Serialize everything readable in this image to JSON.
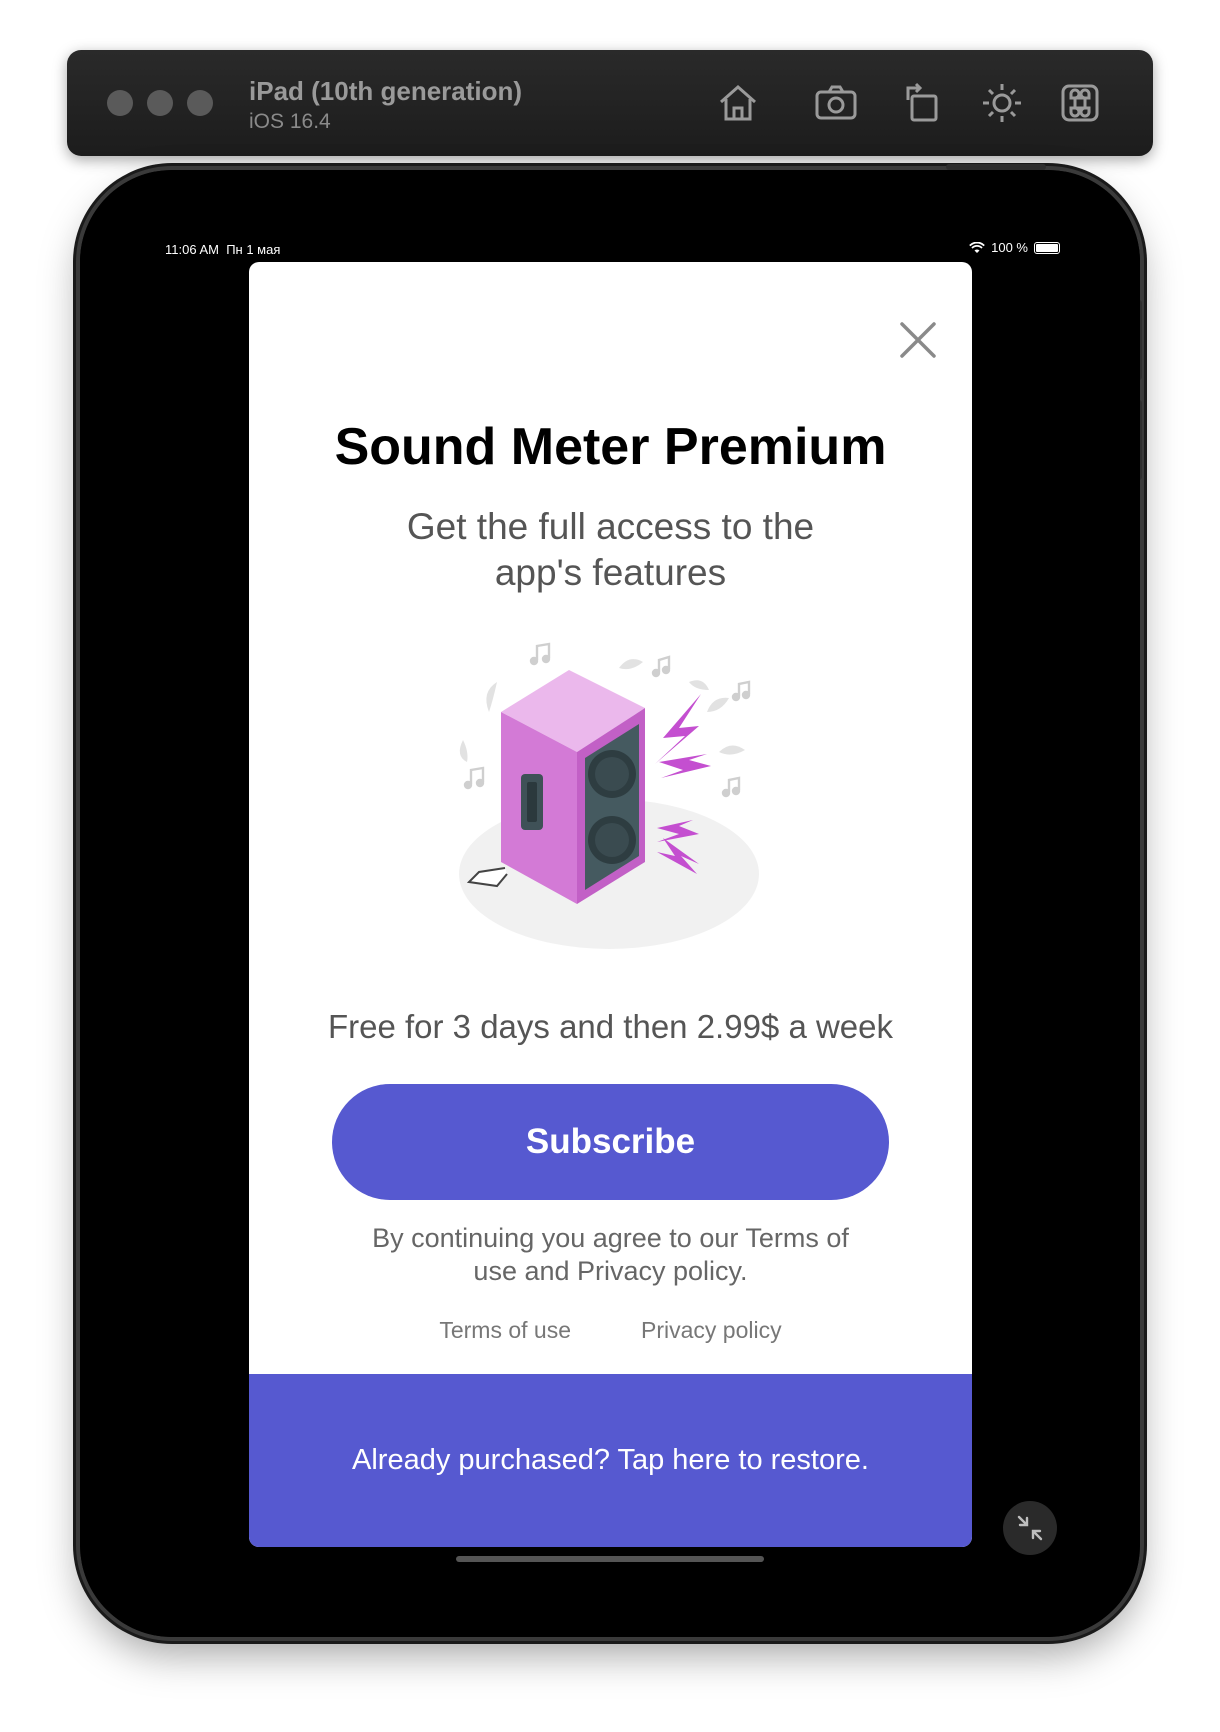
{
  "simulator": {
    "device_name": "iPad (10th generation)",
    "os_version": "iOS 16.4",
    "toolbar_icons": [
      "home-icon",
      "screenshot-icon",
      "rotate-icon",
      "appearance-icon",
      "command-icon"
    ]
  },
  "status_bar": {
    "time": "11:06 AM",
    "date": "Пн 1 мая",
    "battery": "100 %"
  },
  "paywall": {
    "title": "Sound Meter Premium",
    "subtitle": "Get the full access to the app's features",
    "price_text": "Free for 3 days and then 2.99$ a week",
    "subscribe_label": "Subscribe",
    "legal_text": "By continuing you agree to our Terms of use and Privacy policy.",
    "links": {
      "terms": "Terms of use",
      "privacy": "Privacy policy"
    },
    "restore_label": "Already purchased? Tap here to restore."
  },
  "colors": {
    "accent": "#5659d0",
    "speaker_body": "#d37ad6",
    "speaker_front": "#455a60"
  }
}
